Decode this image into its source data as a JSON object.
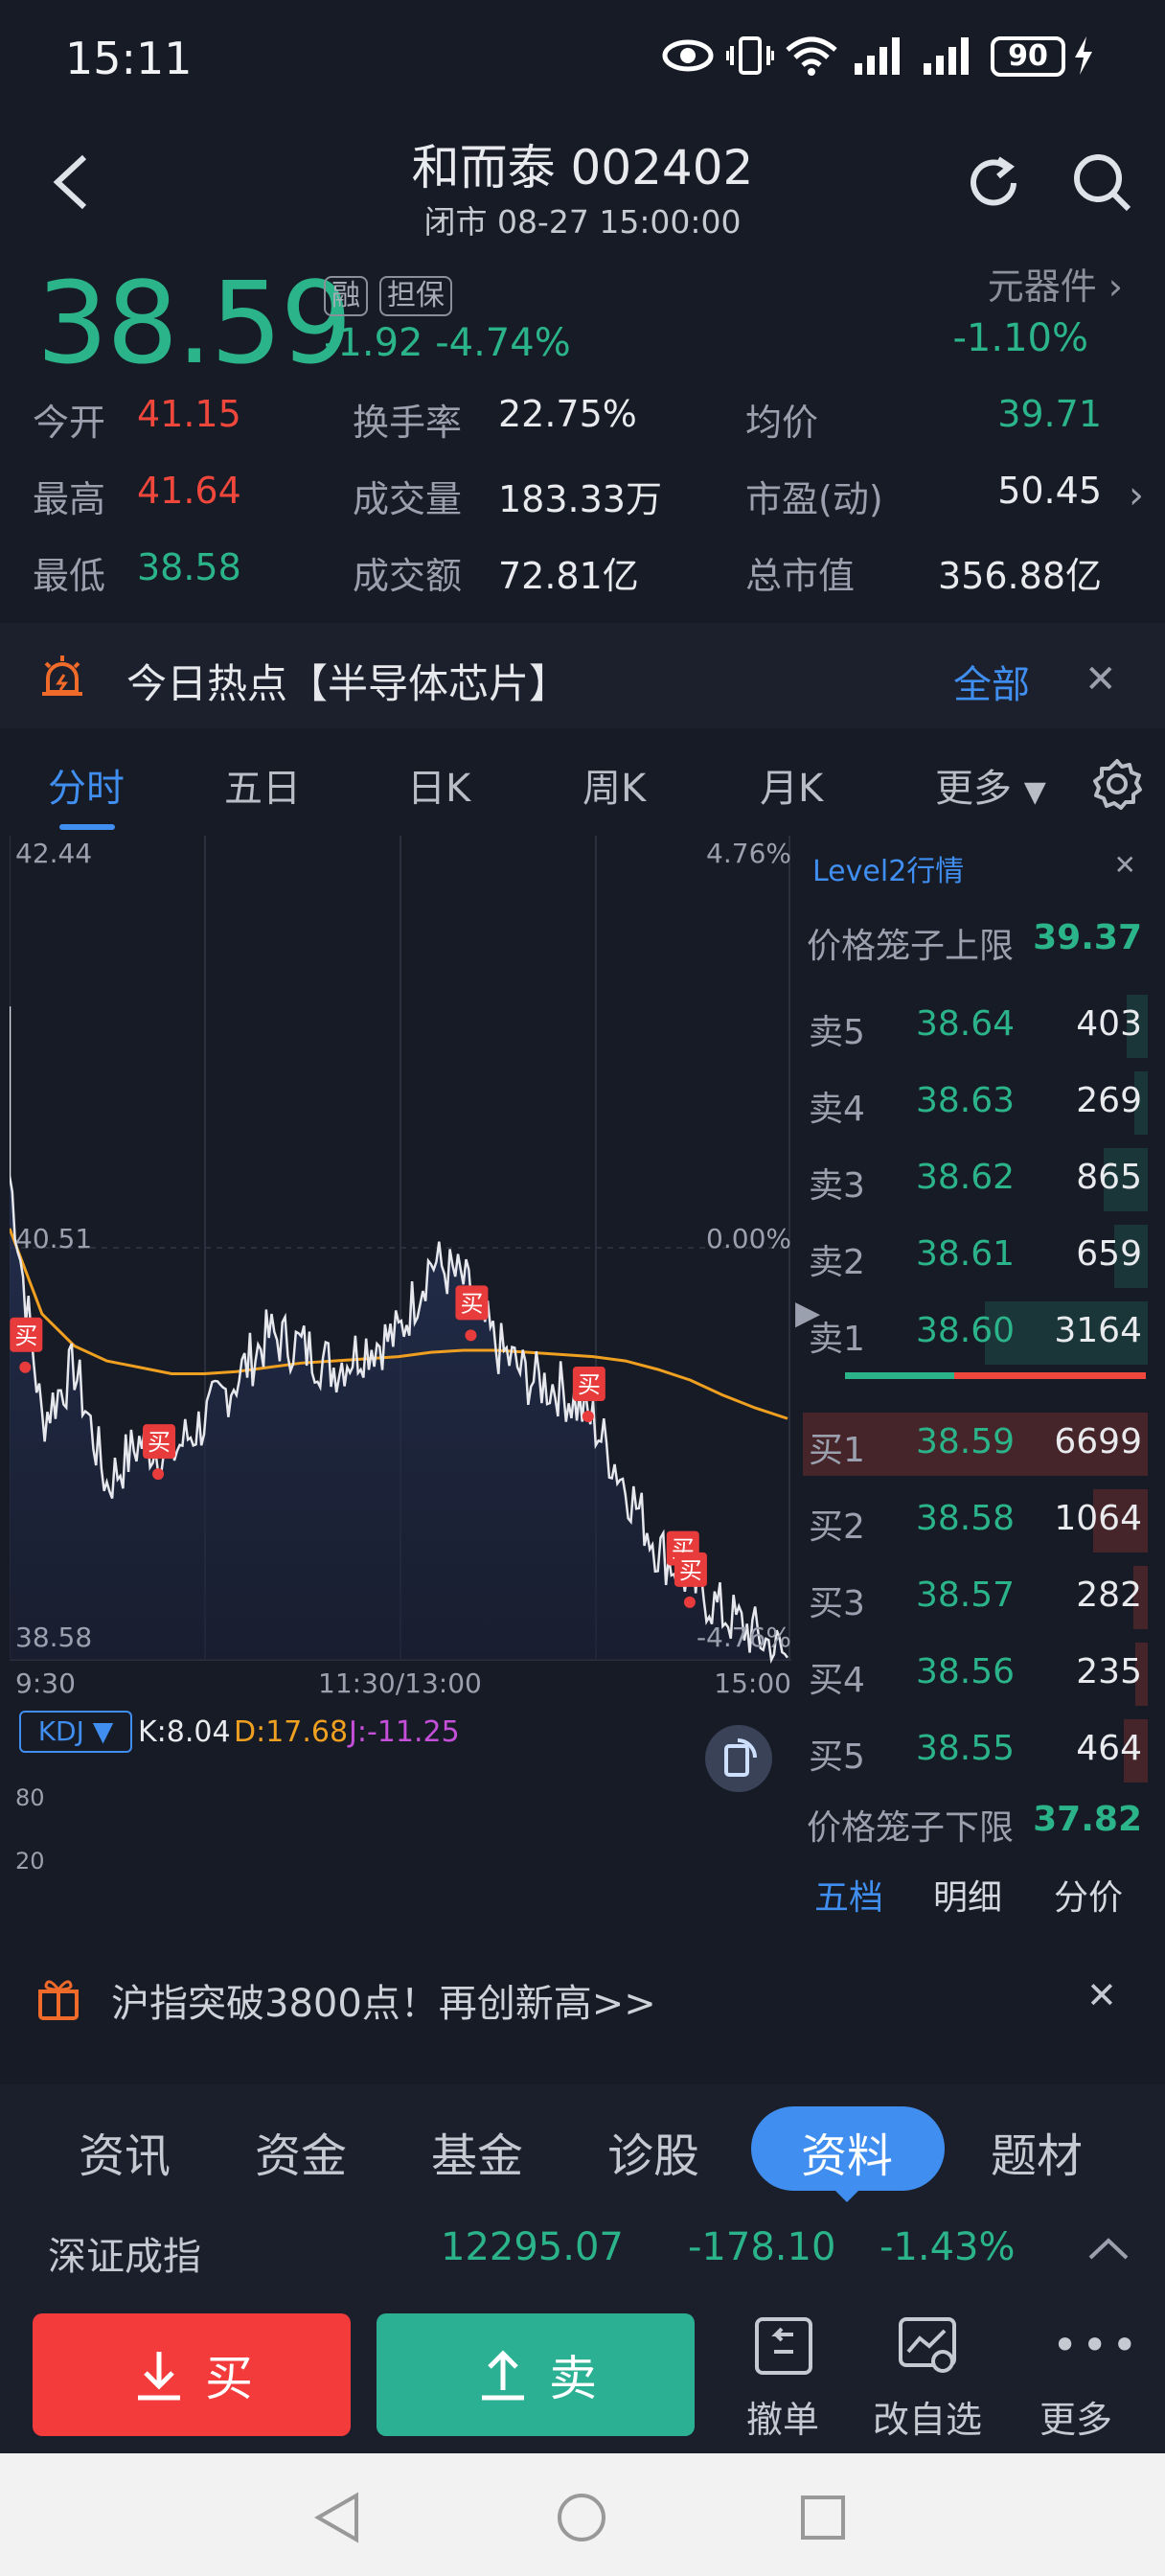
{
  "status_bar": {
    "time": "15:11",
    "battery": "90"
  },
  "header": {
    "title": "和而泰 002402",
    "subtitle": "闭市 08-27 15:00:00"
  },
  "quote": {
    "price": "38.59",
    "tags": [
      "融",
      "担保"
    ],
    "change": "-1.92 -4.74%",
    "sector_name": "元器件",
    "sector_change": "-1.10%",
    "stats": [
      {
        "label": "今开",
        "value": "41.15",
        "color": "red"
      },
      {
        "label": "最高",
        "value": "41.64",
        "color": "red"
      },
      {
        "label": "最低",
        "value": "38.58",
        "color": "green"
      },
      {
        "label": "换手率",
        "value": "22.75%",
        "color": "white"
      },
      {
        "label": "成交量",
        "value": "183.33万",
        "color": "white"
      },
      {
        "label": "成交额",
        "value": "72.81亿",
        "color": "white"
      },
      {
        "label": "均价",
        "value": "39.71",
        "color": "green"
      },
      {
        "label": "市盈(动)",
        "value": "50.45",
        "color": "white"
      },
      {
        "label": "总市值",
        "value": "356.88亿",
        "color": "white"
      }
    ]
  },
  "hot": {
    "text": "今日热点【半导体芯片】",
    "all_label": "全部",
    "close": "✕"
  },
  "kline_tabs": [
    "分时",
    "五日",
    "日K",
    "周K",
    "月K",
    "更多"
  ],
  "chart_labels": {
    "y_top": "42.44",
    "y_mid": "40.51",
    "y_bottom": "38.58",
    "pct_top": "4.76%",
    "pct_mid": "0.00%",
    "pct_bottom": "-4.76%",
    "x_start": "9:30",
    "x_mid": "11:30/13:00",
    "x_end": "15:00",
    "buy_marker": "买",
    "kdj_label": "KDJ ▼",
    "kdj_k": "K:8.04",
    "kdj_d": "D:17.68",
    "kdj_j": "J:-11.25",
    "kdj_80": "80",
    "kdj_20": "20"
  },
  "chart_data": {
    "type": "line",
    "x": [
      "9:30",
      "9:40",
      "9:50",
      "10:00",
      "10:10",
      "10:20",
      "10:30",
      "10:40",
      "10:50",
      "11:00",
      "11:10",
      "11:20",
      "11:30",
      "13:10",
      "13:20",
      "13:30",
      "13:40",
      "13:50",
      "14:00",
      "14:10",
      "14:20",
      "14:30",
      "14:40",
      "14:50",
      "15:00"
    ],
    "series": [
      {
        "values": [
          40.85,
          39.7,
          39.95,
          39.4,
          39.6,
          39.55,
          39.7,
          39.9,
          40.1,
          40.05,
          39.95,
          40.05,
          40.1,
          40.45,
          40.35,
          40.05,
          39.9,
          39.85,
          39.7,
          39.4,
          39.1,
          38.95,
          38.8,
          38.7,
          38.59
        ]
      },
      {
        "values": [
          40.6,
          40.2,
          40.05,
          39.98,
          39.95,
          39.92,
          39.92,
          39.93,
          39.95,
          39.97,
          39.98,
          39.99,
          40.0,
          40.02,
          40.03,
          40.03,
          40.02,
          40.01,
          40.0,
          39.98,
          39.94,
          39.89,
          39.82,
          39.76,
          39.71
        ]
      }
    ],
    "ylim": [
      38.58,
      42.44
    ],
    "reference": 40.51
  },
  "level2": {
    "title": "Level2行情",
    "close": "✕",
    "upper_limit_label": "价格笼子上限",
    "upper_limit_value": "39.37",
    "lower_limit_label": "价格笼子下限",
    "lower_limit_value": "37.82",
    "asks": [
      {
        "label": "卖5",
        "price": "38.64",
        "volume": "403"
      },
      {
        "label": "卖4",
        "price": "38.63",
        "volume": "269"
      },
      {
        "label": "卖3",
        "price": "38.62",
        "volume": "865"
      },
      {
        "label": "卖2",
        "price": "38.61",
        "volume": "659"
      },
      {
        "label": "卖1",
        "price": "38.60",
        "volume": "3164"
      }
    ],
    "bids": [
      {
        "label": "买1",
        "price": "38.59",
        "volume": "6699"
      },
      {
        "label": "买2",
        "price": "38.58",
        "volume": "1064"
      },
      {
        "label": "买3",
        "price": "38.57",
        "volume": "282"
      },
      {
        "label": "买4",
        "price": "38.56",
        "volume": "235"
      },
      {
        "label": "买5",
        "price": "38.55",
        "volume": "464"
      }
    ],
    "subtabs": [
      "五档",
      "明细",
      "分价"
    ]
  },
  "promo": {
    "text": "沪指突破3800点！再创新高>>",
    "close": "✕"
  },
  "bottom_tabs": [
    "资讯",
    "资金",
    "基金",
    "诊股",
    "资料",
    "题材"
  ],
  "index_bar": {
    "name": "深证成指",
    "value": "12295.07",
    "change": "-178.10",
    "pct": "-1.43%"
  },
  "actions": {
    "buy": "买",
    "sell": "卖",
    "cancel": "撤单",
    "edit_watch": "改自选",
    "more": "更多"
  },
  "colors": {
    "up": "#f0473c",
    "down": "#2bb48a",
    "accent": "#3f8ef0",
    "avg_line": "#f0a020"
  }
}
